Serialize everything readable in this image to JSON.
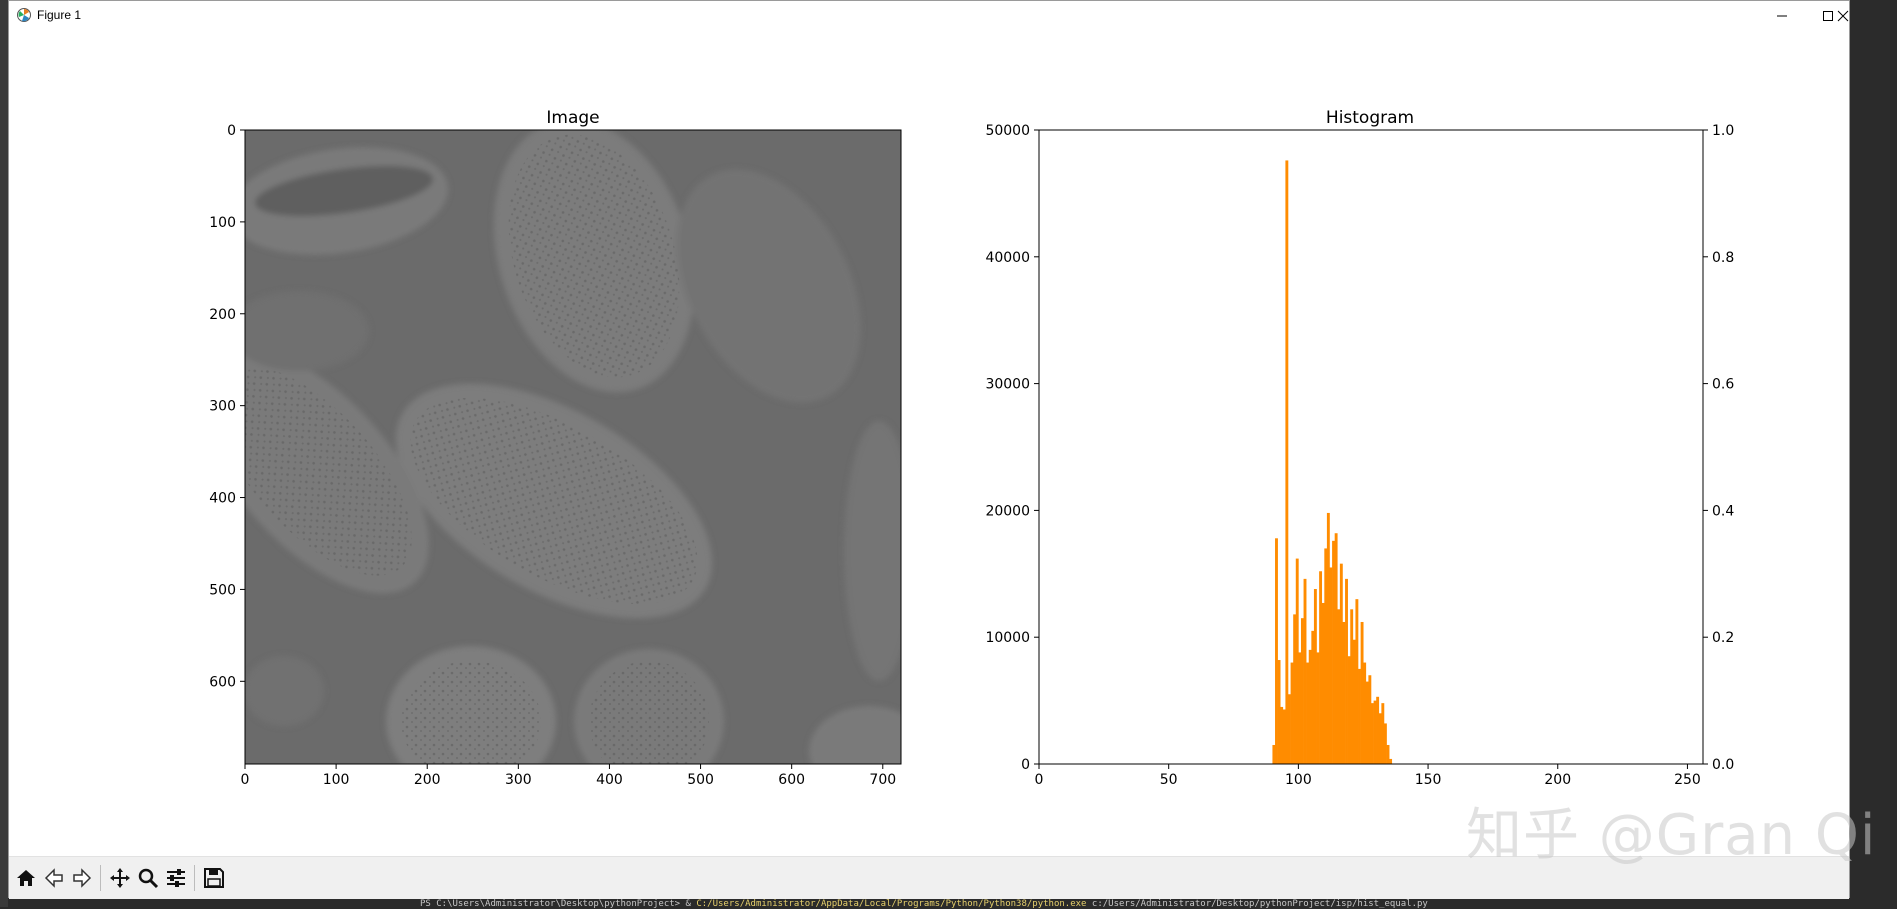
{
  "window": {
    "title": "Figure 1"
  },
  "toolbar": {
    "buttons": [
      "home-icon",
      "back-icon",
      "forward-icon",
      "pan-icon",
      "zoom-icon",
      "configure-subplots-icon",
      "save-icon"
    ]
  },
  "terminal": {
    "prefix": "PS C:\\Users\\Administrator\\Desktop\\pythonProject> & ",
    "path": "C:/Users/Administrator/AppData/Local/Programs/Python/Python38/python.exe",
    "suffix": " c:/Users/Administrator/Desktop/pythonProject/isp/hist_equal.py"
  },
  "watermark": "知乎 @Gran Qi",
  "colors": {
    "bar": "#ff8c00",
    "image_gray": "#6b6b6b"
  },
  "chart_data": [
    {
      "type": "image",
      "title": "Image",
      "xlim": [
        0,
        720
      ],
      "ylim": [
        690,
        0
      ],
      "xticks": [
        "0",
        "100",
        "200",
        "300",
        "400",
        "500",
        "600",
        "700"
      ],
      "yticks": [
        "0",
        "100",
        "200",
        "300",
        "400",
        "500",
        "600"
      ]
    },
    {
      "type": "bar",
      "title": "Histogram",
      "xlim": [
        0,
        256
      ],
      "ylim": [
        0,
        50000
      ],
      "xticks": [
        "0",
        "50",
        "100",
        "150",
        "200",
        "250"
      ],
      "yticks": [
        "0",
        "10000",
        "20000",
        "30000",
        "40000",
        "50000"
      ],
      "y2lim": [
        0,
        1.0
      ],
      "y2ticks": [
        "0.0",
        "0.2",
        "0.4",
        "0.6",
        "0.8",
        "1.0"
      ],
      "x": [
        90,
        91,
        92,
        93,
        94,
        95,
        96,
        97,
        98,
        99,
        100,
        101,
        102,
        103,
        104,
        105,
        106,
        107,
        108,
        109,
        110,
        111,
        112,
        113,
        114,
        115,
        116,
        117,
        118,
        119,
        120,
        121,
        122,
        123,
        124,
        125,
        126,
        127,
        128,
        129,
        130,
        131,
        132,
        133,
        134,
        135
      ],
      "values": [
        1500,
        17800,
        8200,
        4500,
        4300,
        47600,
        5500,
        8000,
        11800,
        16200,
        8800,
        11500,
        14600,
        8000,
        9000,
        10500,
        13800,
        8800,
        15200,
        12700,
        17000,
        19800,
        15500,
        17600,
        18200,
        12200,
        15800,
        11200,
        14600,
        8500,
        12200,
        9800,
        13000,
        7500,
        11200,
        8000,
        6500,
        7000,
        4800,
        5000,
        5300,
        4000,
        4800,
        3200,
        1500,
        400
      ]
    }
  ]
}
